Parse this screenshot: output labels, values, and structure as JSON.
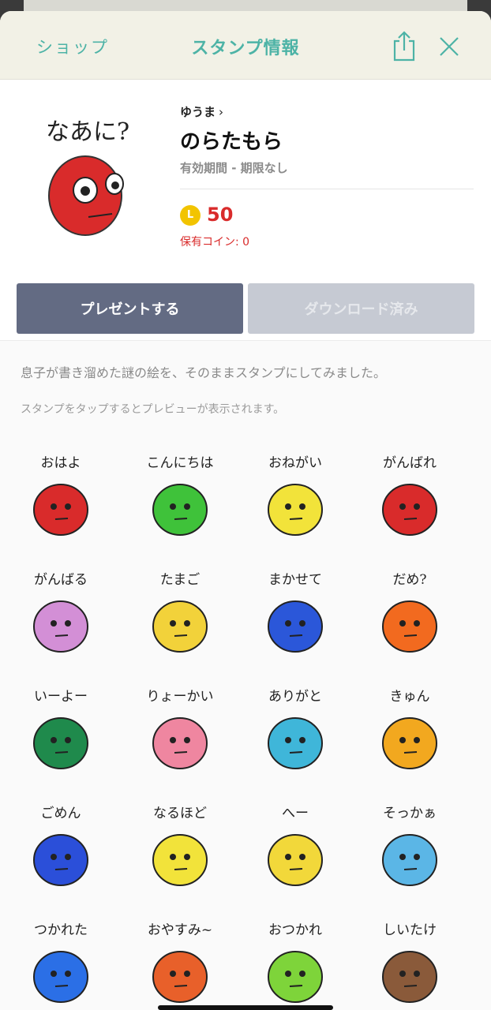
{
  "header": {
    "shop_label": "ショップ",
    "title": "スタンプ情報",
    "share_icon": "share-icon",
    "close_icon": "close-icon"
  },
  "pack": {
    "main_sticker_caption": "なあに?",
    "author": "ゆうま",
    "title": "のらたもら",
    "validity": "有効期間 - 期限なし",
    "coin_symbol": "L",
    "price": "50",
    "owned_coins": "保有コイン: 0",
    "present_button": "プレゼントする",
    "downloaded_button": "ダウンロード済み"
  },
  "description": "息子が書き溜めた謎の絵を、そのままスタンプにしてみました。",
  "preview_hint": "スタンプをタップするとプレビューが表示されます。",
  "stickers": [
    {
      "caption": "おはよ",
      "color": "#d92b2b"
    },
    {
      "caption": "こんにちは",
      "color": "#3fc23a"
    },
    {
      "caption": "おねがい",
      "color": "#f2e33a"
    },
    {
      "caption": "がんばれ",
      "color": "#d92b2b"
    },
    {
      "caption": "がんばる",
      "color": "#d38fd6"
    },
    {
      "caption": "たまご",
      "color": "#f2d23a"
    },
    {
      "caption": "まかせて",
      "color": "#2b57d9"
    },
    {
      "caption": "だめ?",
      "color": "#f26a1f"
    },
    {
      "caption": "いーよー",
      "color": "#1f8a4c"
    },
    {
      "caption": "りょーかい",
      "color": "#ef86a0"
    },
    {
      "caption": "ありがと",
      "color": "#3fb6d9"
    },
    {
      "caption": "きゅん",
      "color": "#f2a81f"
    },
    {
      "caption": "ごめん",
      "color": "#2b4fd9"
    },
    {
      "caption": "なるほど",
      "color": "#f2e33a"
    },
    {
      "caption": "へー",
      "color": "#f2d83a"
    },
    {
      "caption": "そっかぁ",
      "color": "#5bb6e6"
    },
    {
      "caption": "つかれた",
      "color": "#2b6fe6"
    },
    {
      "caption": "おやすみ~",
      "color": "#e8602a"
    },
    {
      "caption": "おつかれ",
      "color": "#7ed43a"
    },
    {
      "caption": "しいたけ",
      "color": "#8a5a3a"
    }
  ]
}
